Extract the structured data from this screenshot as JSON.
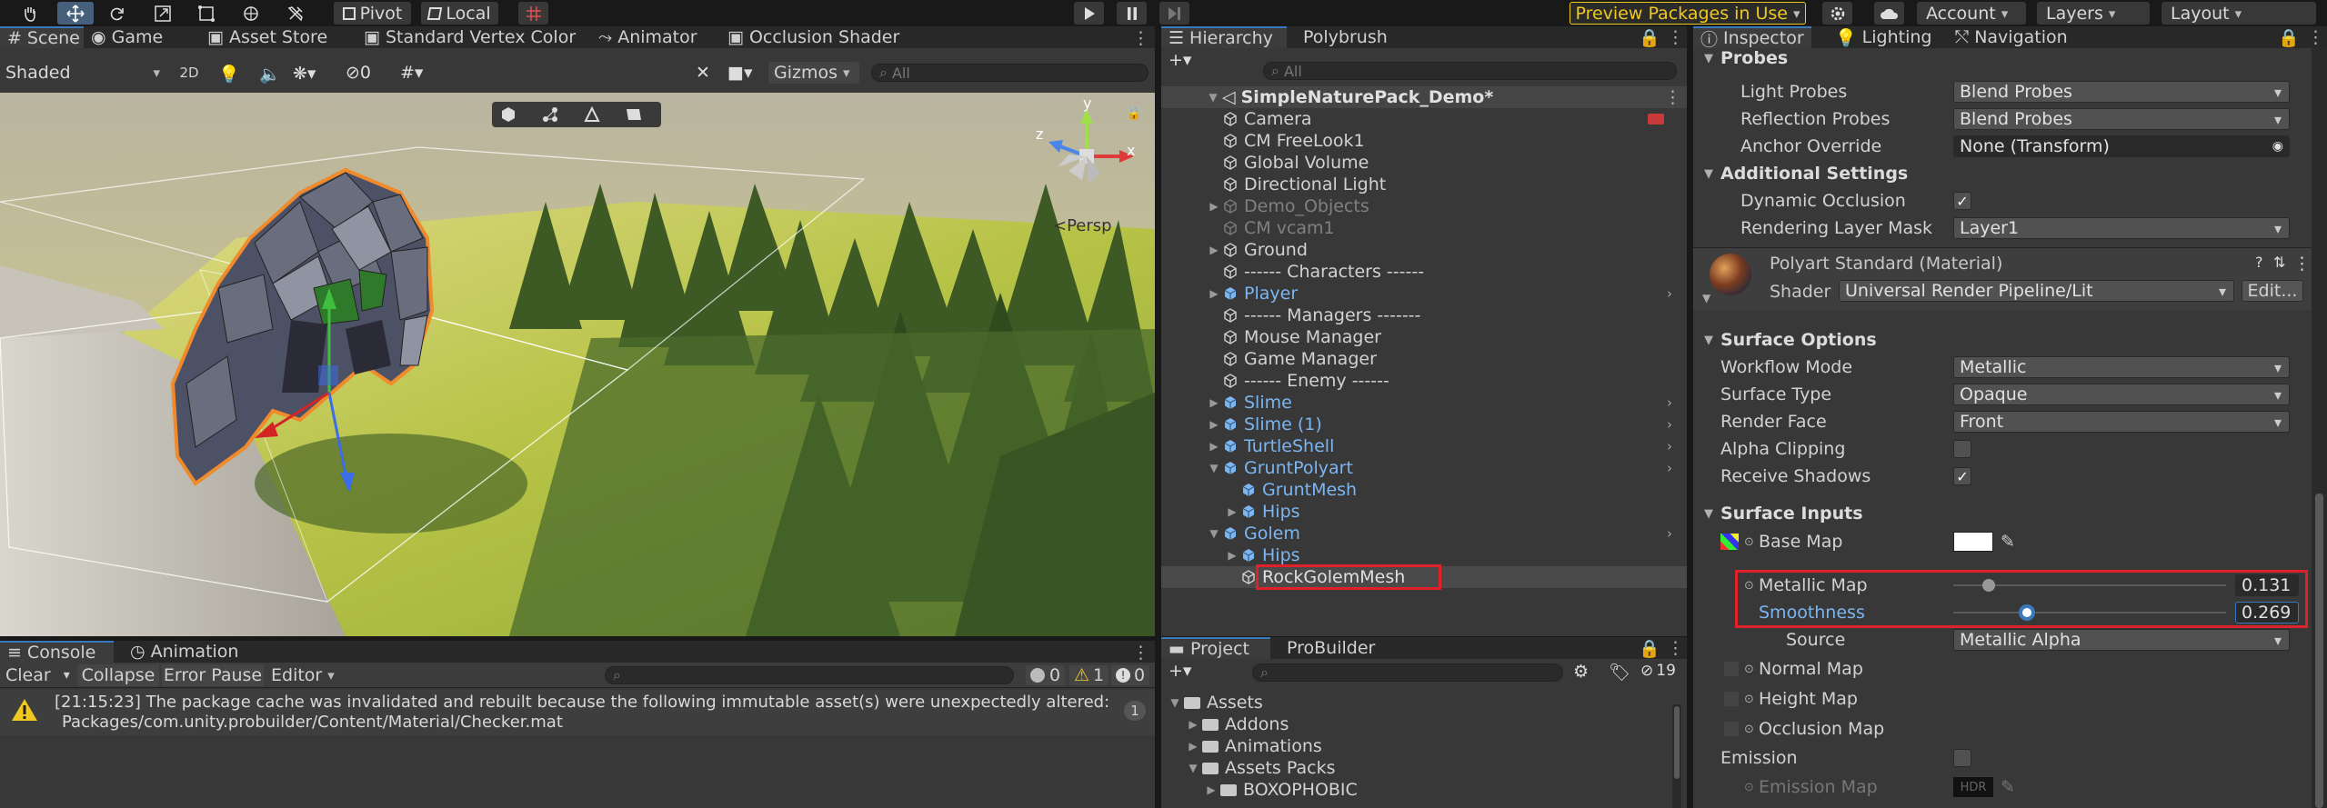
{
  "toolbar": {
    "pivot": "Pivot",
    "local": "Local",
    "preview": "Preview Packages in Use",
    "account": "Account",
    "layers": "Layers",
    "layout": "Layout"
  },
  "scene": {
    "tabs": [
      "Scene",
      "Game",
      "Asset Store",
      "Standard Vertex Color",
      "Animator",
      "Occlusion Shader"
    ],
    "shading": "Shaded",
    "mode_2d": "2D",
    "hidden_count": "0",
    "gizmos": "Gizmos",
    "search_placeholder": "All",
    "persp": "Persp",
    "gizmo_axes": {
      "x": "x",
      "y": "y",
      "z": "z"
    }
  },
  "console": {
    "tabs": [
      "Console",
      "Animation"
    ],
    "clear": "Clear",
    "collapse": "Collapse",
    "error_pause": "Error Pause",
    "editor": "Editor",
    "log_count": "0",
    "warn_count": "1",
    "error_count": "0",
    "message_line1": "[21:15:23] The package cache was invalidated and rebuilt because the following immutable asset(s) were unexpectedly altered:",
    "message_line2": "Packages/com.unity.probuilder/Content/Material/Checker.mat",
    "message_count": "1"
  },
  "hierarchy": {
    "tabs": [
      "Hierarchy",
      "Polybrush"
    ],
    "search_placeholder": "All",
    "scene_name": "SimpleNaturePack_Demo*",
    "items": [
      {
        "label": "Camera",
        "indent": 1,
        "style": "normal",
        "arrow": ""
      },
      {
        "label": "CM FreeLook1",
        "indent": 1,
        "style": "normal",
        "arrow": ""
      },
      {
        "label": "Global Volume",
        "indent": 1,
        "style": "normal",
        "arrow": ""
      },
      {
        "label": "Directional Light",
        "indent": 1,
        "style": "normal",
        "arrow": ""
      },
      {
        "label": "Demo_Objects",
        "indent": 1,
        "style": "grey",
        "arrow": "▶"
      },
      {
        "label": "CM vcam1",
        "indent": 1,
        "style": "grey",
        "arrow": ""
      },
      {
        "label": "Ground",
        "indent": 1,
        "style": "normal",
        "arrow": "▶"
      },
      {
        "label": "------ Characters ------",
        "indent": 1,
        "style": "normal",
        "arrow": ""
      },
      {
        "label": "Player",
        "indent": 1,
        "style": "blue",
        "arrow": "▶"
      },
      {
        "label": "------ Managers -------",
        "indent": 1,
        "style": "normal",
        "arrow": ""
      },
      {
        "label": "Mouse Manager",
        "indent": 1,
        "style": "normal",
        "arrow": ""
      },
      {
        "label": "Game Manager",
        "indent": 1,
        "style": "normal",
        "arrow": ""
      },
      {
        "label": "------ Enemy ------",
        "indent": 1,
        "style": "normal",
        "arrow": ""
      },
      {
        "label": "Slime",
        "indent": 1,
        "style": "blue",
        "arrow": "▶"
      },
      {
        "label": "Slime (1)",
        "indent": 1,
        "style": "blue",
        "arrow": "▶"
      },
      {
        "label": "TurtleShell",
        "indent": 1,
        "style": "blue",
        "arrow": "▶"
      },
      {
        "label": "GruntPolyart",
        "indent": 1,
        "style": "blue",
        "arrow": "▼"
      },
      {
        "label": "GruntMesh",
        "indent": 2,
        "style": "blue",
        "arrow": ""
      },
      {
        "label": "Hips",
        "indent": 2,
        "style": "blue",
        "arrow": "▶"
      },
      {
        "label": "Golem",
        "indent": 1,
        "style": "blue",
        "arrow": "▼"
      },
      {
        "label": "Hips",
        "indent": 2,
        "style": "blue",
        "arrow": "▶"
      },
      {
        "label": "RockGolemMesh",
        "indent": 2,
        "style": "selected",
        "arrow": ""
      }
    ]
  },
  "project": {
    "tabs": [
      "Project",
      "ProBuilder"
    ],
    "hidden_count": "19",
    "tree": [
      {
        "label": "Assets",
        "indent": 0,
        "arrow": "▼"
      },
      {
        "label": "Addons",
        "indent": 1,
        "arrow": "▶"
      },
      {
        "label": "Animations",
        "indent": 1,
        "arrow": "▶"
      },
      {
        "label": "Assets Packs",
        "indent": 1,
        "arrow": "▼"
      },
      {
        "label": "BOXOPHOBIC",
        "indent": 2,
        "arrow": "▶"
      }
    ]
  },
  "inspector": {
    "tabs": [
      "Inspector",
      "Lighting",
      "Navigation"
    ],
    "probes_header": "Probes",
    "light_probes_label": "Light Probes",
    "light_probes_value": "Blend Probes",
    "reflection_probes_label": "Reflection Probes",
    "reflection_probes_value": "Blend Probes",
    "anchor_override_label": "Anchor Override",
    "anchor_override_value": "None (Transform)",
    "additional_header": "Additional Settings",
    "dynamic_occlusion_label": "Dynamic Occlusion",
    "rendering_layer_label": "Rendering Layer Mask",
    "rendering_layer_value": "Layer1",
    "material_name": "Polyart Standard (Material)",
    "shader_label": "Shader",
    "shader_value": "Universal Render Pipeline/Lit",
    "edit_button": "Edit...",
    "surface_options_header": "Surface Options",
    "workflow_label": "Workflow Mode",
    "workflow_value": "Metallic",
    "surface_type_label": "Surface Type",
    "surface_type_value": "Opaque",
    "render_face_label": "Render Face",
    "render_face_value": "Front",
    "alpha_clipping_label": "Alpha Clipping",
    "receive_shadows_label": "Receive Shadows",
    "surface_inputs_header": "Surface Inputs",
    "base_map_label": "Base Map",
    "metallic_map_label": "Metallic Map",
    "metallic_value": "0.131",
    "smoothness_label": "Smoothness",
    "smoothness_value": "0.269",
    "source_label": "Source",
    "source_value": "Metallic Alpha",
    "normal_map_label": "Normal Map",
    "height_map_label": "Height Map",
    "occlusion_map_label": "Occlusion Map",
    "emission_label": "Emission",
    "emission_map_label": "Emission Map",
    "hdr_label": "HDR",
    "metallic_fraction": 0.131,
    "smoothness_fraction": 0.269
  },
  "colors": {
    "highlight_red": "#e0202a",
    "prefab_blue": "#7cb6f2",
    "accent_yellow": "#f0c820",
    "selection_blue": "#2c5d87"
  }
}
